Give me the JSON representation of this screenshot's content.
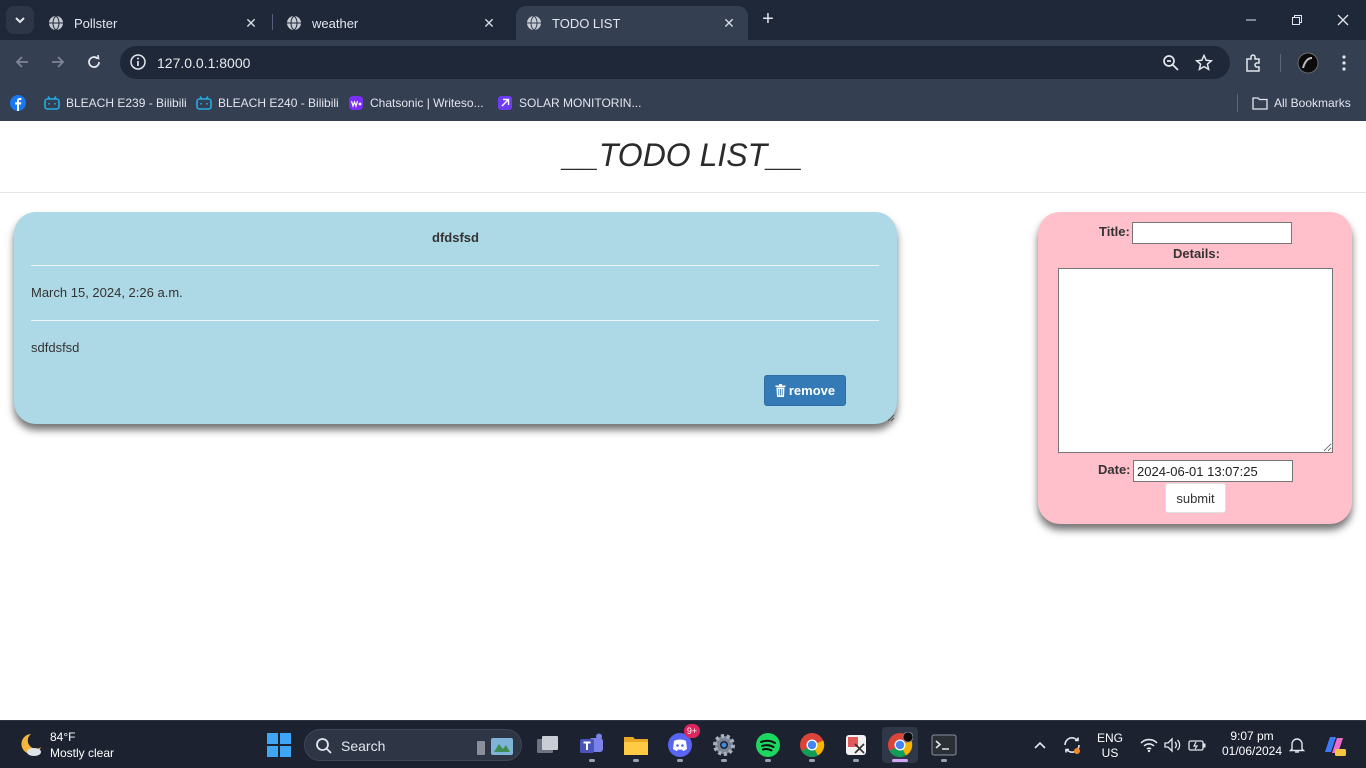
{
  "browser": {
    "tabs": [
      {
        "title": "Pollster",
        "active": false
      },
      {
        "title": "weather",
        "active": false
      },
      {
        "title": "TODO LIST",
        "active": true
      }
    ],
    "new_tab_symbol": "+",
    "close_symbol": "✕",
    "url": "127.0.0.1:8000",
    "bookmarks": [
      {
        "label": "",
        "icon": "facebook-icon"
      },
      {
        "label": "BLEACH E239 - Bilibili",
        "icon": "bilibili-icon"
      },
      {
        "label": "BLEACH E240 - Bilibili",
        "icon": "bilibili-icon"
      },
      {
        "label": "Chatsonic | Writeso...",
        "icon": "writesonic-icon"
      },
      {
        "label": "SOLAR MONITORIN...",
        "icon": "solar-app-icon"
      }
    ],
    "all_bookmarks_label": "All Bookmarks"
  },
  "page": {
    "title": "__TODO LIST__",
    "todo": {
      "title": "dfdsfsd",
      "date": "March 15, 2024, 2:26 a.m.",
      "details": "sdfdsfsd",
      "remove_label": "remove"
    },
    "form": {
      "title_label": "Title:",
      "title_value": "",
      "details_label": "Details:",
      "details_value": "",
      "date_label": "Date:",
      "date_value": "2024-06-01 13:07:25",
      "submit_label": "submit"
    }
  },
  "taskbar": {
    "weather_temp": "84°F",
    "weather_desc": "Mostly clear",
    "search_label": "Search",
    "discord_badge": "9+",
    "lang_primary": "ENG",
    "lang_secondary": "US",
    "time": "9:07 pm",
    "date": "01/06/2024"
  },
  "colors": {
    "todo_card_bg": "#add8e6",
    "form_card_bg": "#ffc0cb",
    "remove_button_bg": "#337ab7",
    "browser_frame": "#1f2838"
  }
}
